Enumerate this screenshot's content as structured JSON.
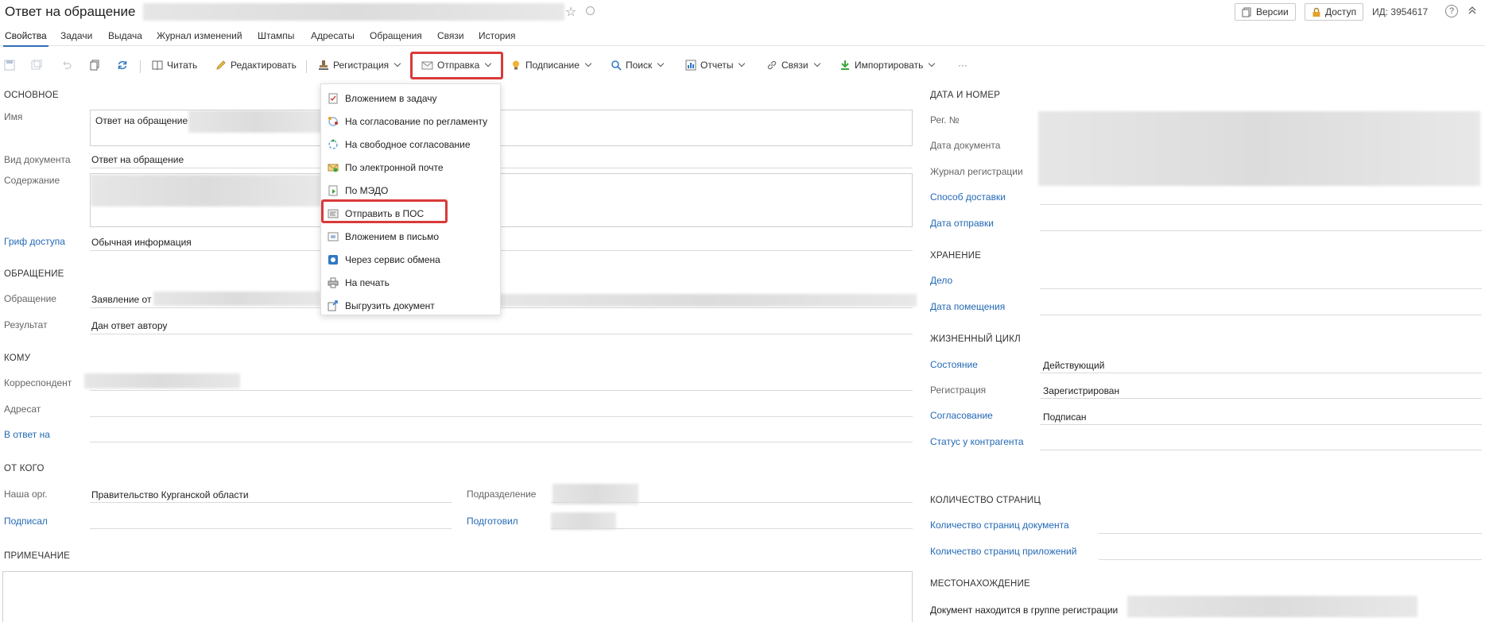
{
  "header": {
    "title": "Ответ на обращение",
    "versions_label": "Версии",
    "access_label": "Доступ",
    "id_text": "ИД: 3954617",
    "help_label": "?"
  },
  "tabs": [
    "Свойства",
    "Задачи",
    "Выдача",
    "Журнал изменений",
    "Штампы",
    "Адресаты",
    "Обращения",
    "Связи",
    "История"
  ],
  "toolbar": {
    "read": "Читать",
    "edit": "Редактировать",
    "registration": "Регистрация",
    "send": "Отправка",
    "signing": "Подписание",
    "search": "Поиск",
    "reports": "Отчеты",
    "links": "Связи",
    "import": "Импортировать",
    "more": "···"
  },
  "send_menu": [
    "Вложением в задачу",
    "На согласование по регламенту",
    "На свободное согласование",
    "По электронной почте",
    "По МЭДО",
    "Отправить в ПОС",
    "Вложением в письмо",
    "Через сервис обмена",
    "На печать",
    "Выгрузить документ"
  ],
  "main": {
    "section_main": "ОСНОВНОЕ",
    "name_label": "Имя",
    "name_value": "Ответ на обращение",
    "doctype_label": "Вид документа",
    "doctype_value": "Ответ на обращение",
    "content_label": "Содержание",
    "access_label": "Гриф доступа",
    "access_value": "Обычная информация",
    "section_appeal": "ОБРАЩЕНИЕ",
    "appeal_label": "Обращение",
    "appeal_value": "Заявление от",
    "result_label": "Результат",
    "result_value": "Дан ответ автору",
    "section_to": "КОМУ",
    "correspondent_label": "Корреспондент",
    "addressee_label": "Адресат",
    "reply_to_label": "В ответ на",
    "section_from": "ОТ КОГО",
    "our_org_label": "Наша орг.",
    "our_org_value": "Правительство Курганской области",
    "department_label": "Подразделение",
    "signed_label": "Подписал",
    "prepared_label": "Подготовил",
    "section_note": "ПРИМЕЧАНИЕ"
  },
  "right": {
    "section_date": "ДАТА И НОМЕР",
    "reg_no_label": "Рег. №",
    "doc_date_label": "Дата документа",
    "journal_label": "Журнал регистрации",
    "delivery_label": "Способ доставки",
    "send_date_label": "Дата отправки",
    "section_storage": "ХРАНЕНИЕ",
    "case_label": "Дело",
    "placed_date_label": "Дата помещения",
    "section_lifecycle": "ЖИЗНЕННЫЙ ЦИКЛ",
    "state_label": "Состояние",
    "state_value": "Действующий",
    "registration_label": "Регистрация",
    "registration_value": "Зарегистрирован",
    "approval_label": "Согласование",
    "approval_value": "Подписан",
    "counterparty_label": "Статус у контрагента",
    "section_pages": "КОЛИЧЕСТВО СТРАНИЦ",
    "doc_pages_label": "Количество страниц документа",
    "attach_pages_label": "Количество страниц приложений",
    "section_location": "МЕСТОНАХОЖДЕНИЕ",
    "location_value": "Документ находится в группе регистрации"
  },
  "colors": {
    "accent": "#2f6eb5",
    "link": "#2469b5",
    "highlight": "#d93a3a"
  }
}
